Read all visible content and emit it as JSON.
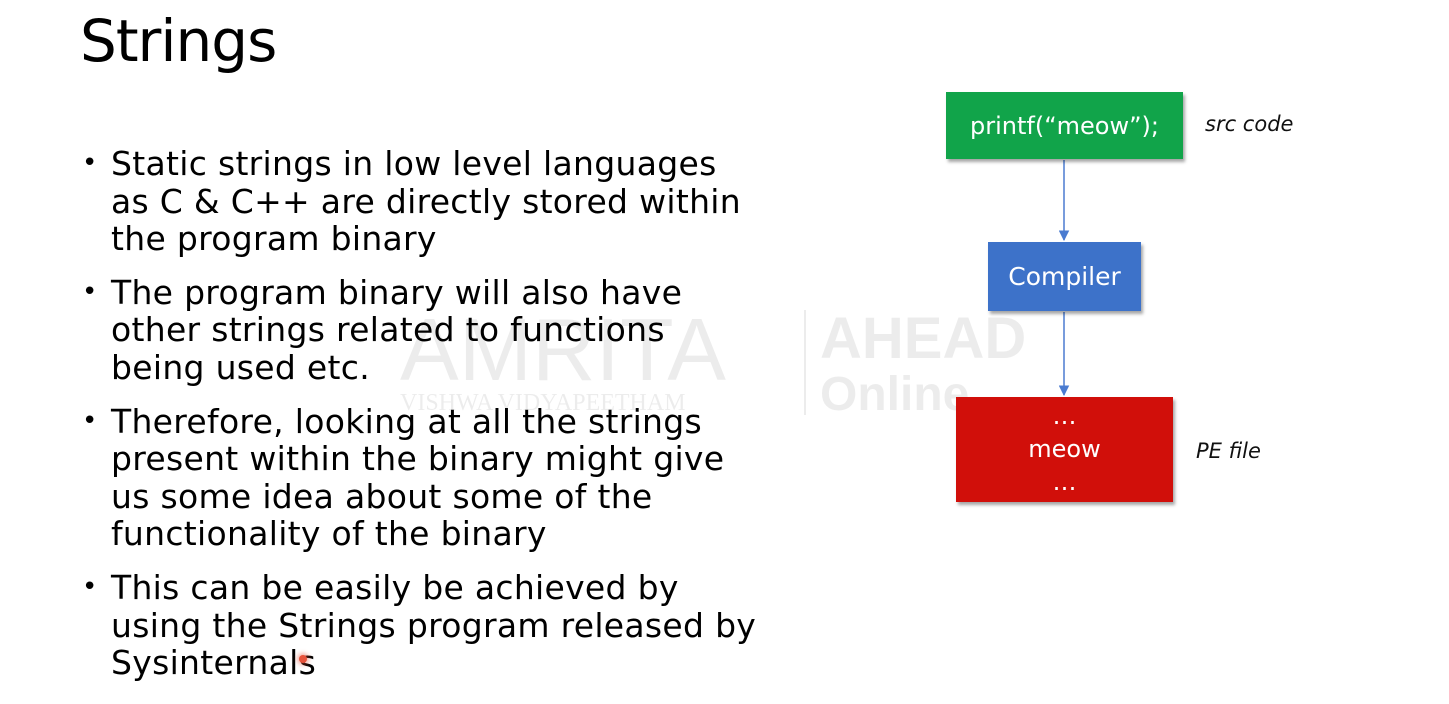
{
  "slide": {
    "title": "Strings",
    "bullets": [
      "Static strings in low level languages as C & C++ are directly stored within the program binary",
      "The program binary will also have other strings related to functions being used etc.",
      "Therefore, looking at all the strings present within the binary might give us some idea about some of the functionality of the binary",
      "This can be easily be achieved by using the Strings program released by Sysinternals"
    ],
    "bullet_marker": "•"
  },
  "diagram": {
    "src_box": "printf(“meow”);",
    "src_label": "src code",
    "compiler_box": "Compiler",
    "pe_box": {
      "line1": "…",
      "line2": "meow",
      "line3": "…"
    },
    "pe_label": "PE file",
    "colors": {
      "src": "#11a44a",
      "compiler": "#3d72c9",
      "pe": "#d10f0a",
      "arrow": "#4a7bd0"
    }
  },
  "watermark": {
    "brand": "AMRITA",
    "sub": "VISHWA VIDYAPEETHAM",
    "right_top": "AHEAD",
    "right_bottom": "Online"
  }
}
